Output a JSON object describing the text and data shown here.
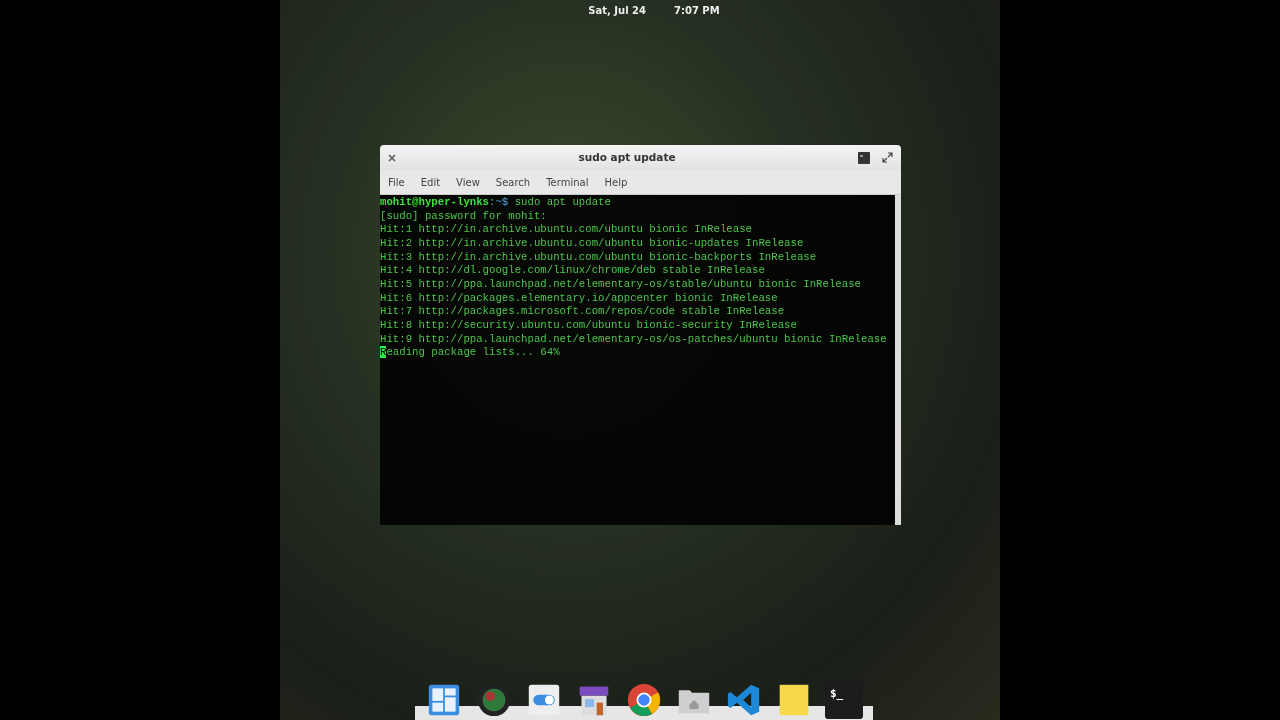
{
  "top_panel": {
    "date": "Sat, Jul 24",
    "time": "7:07 PM"
  },
  "window": {
    "title": "sudo apt update",
    "menu": [
      "File",
      "Edit",
      "View",
      "Search",
      "Terminal",
      "Help"
    ],
    "prompt": {
      "user": "mohit@hyper-lynks",
      "path": ":~$",
      "command": "sudo apt update"
    },
    "lines": [
      "[sudo] password for mohit:",
      "Hit:1 http://in.archive.ubuntu.com/ubuntu bionic InRelease",
      "Hit:2 http://in.archive.ubuntu.com/ubuntu bionic-updates InRelease",
      "Hit:3 http://in.archive.ubuntu.com/ubuntu bionic-backports InRelease",
      "Hit:4 http://dl.google.com/linux/chrome/deb stable InRelease",
      "Hit:5 http://ppa.launchpad.net/elementary-os/stable/ubuntu bionic InRelease",
      "Hit:6 http://packages.elementary.io/appcenter bionic InRelease",
      "Hit:7 http://packages.microsoft.com/repos/code stable InRelease",
      "Hit:8 http://security.ubuntu.com/ubuntu bionic-security InRelease",
      "Hit:9 http://ppa.launchpad.net/elementary-os/os-patches/ubuntu bionic InRelease",
      "Reading package lists... 64%"
    ],
    "cursor_on_last_line": true
  },
  "dock": [
    {
      "kind": "multitasking"
    },
    {
      "kind": "camera"
    },
    {
      "kind": "settings"
    },
    {
      "kind": "store"
    },
    {
      "kind": "browser"
    },
    {
      "kind": "files"
    },
    {
      "kind": "code"
    },
    {
      "kind": "notes"
    },
    {
      "kind": "terminal",
      "label": "$_"
    }
  ]
}
